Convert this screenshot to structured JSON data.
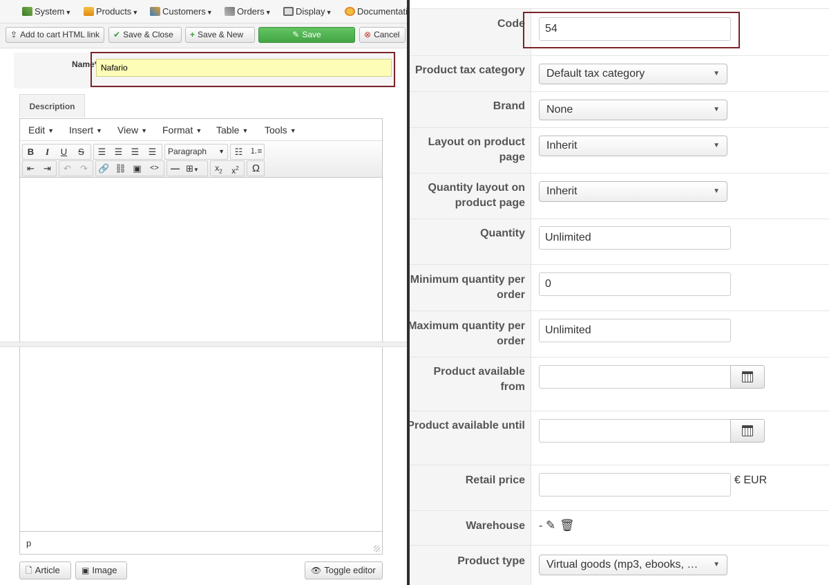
{
  "topmenu": {
    "items": [
      {
        "label": "System",
        "icon": "wrench-icon",
        "color": "#4a8a3a"
      },
      {
        "label": "Products",
        "icon": "box-icon",
        "color": "#e89a1a"
      },
      {
        "label": "Customers",
        "icon": "users-icon",
        "color": "#3a7ac0"
      },
      {
        "label": "Orders",
        "icon": "orders-icon",
        "color": "#9a9a9a"
      },
      {
        "label": "Display",
        "icon": "display-icon",
        "color": "#666666"
      },
      {
        "label": "Documentation",
        "icon": "docs-icon",
        "color": "#e0a030"
      }
    ]
  },
  "toolbar": {
    "add_cart_link": "Add to cart HTML link",
    "save_close": "Save & Close",
    "save_new": "Save & New",
    "save": "Save",
    "cancel": "Cancel"
  },
  "name_field": {
    "label": "Name*",
    "value": "Nafario"
  },
  "description_tab": "Description",
  "editor": {
    "menus": [
      "Edit",
      "Insert",
      "View",
      "Format",
      "Table",
      "Tools"
    ],
    "paragraph_select": "Paragraph",
    "status_path": "p"
  },
  "footer_buttons": {
    "article": "Article",
    "image": "Image",
    "toggle_editor": "Toggle editor"
  },
  "form": {
    "code": {
      "label": "Code",
      "value": "54"
    },
    "tax_category": {
      "label": "Product tax category",
      "value": "Default tax category"
    },
    "brand": {
      "label": "Brand",
      "value": "None"
    },
    "layout_product_page": {
      "label_line1": "Layout on product",
      "label_line2": "page",
      "value": "Inherit"
    },
    "quantity_layout": {
      "label_line1": "Quantity layout on",
      "label_line2": "product page",
      "value": "Inherit"
    },
    "quantity": {
      "label": "Quantity",
      "value": "Unlimited"
    },
    "min_quantity": {
      "label_line1": "Minimum quantity per",
      "label_line2": "order",
      "value": "0"
    },
    "max_quantity": {
      "label_line1": "Maximum quantity per",
      "label_line2": "order",
      "value": "Unlimited"
    },
    "available_from": {
      "label_line1": "Product available",
      "label_line2": "from",
      "value": ""
    },
    "available_until": {
      "label": "Product available until",
      "value": ""
    },
    "retail_price": {
      "label": "Retail price",
      "value": "",
      "currency": "€ EUR"
    },
    "warehouse": {
      "label": "Warehouse",
      "value": "-"
    },
    "product_type": {
      "label": "Product type",
      "value": "Virtual goods (mp3, ebooks, …"
    }
  }
}
